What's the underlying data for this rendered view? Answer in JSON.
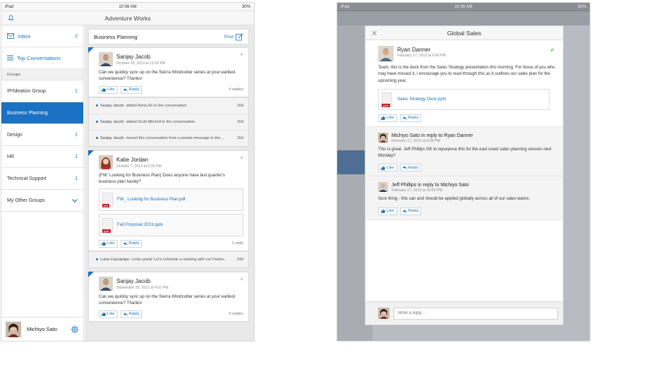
{
  "left": {
    "status": {
      "carrier": "iPad",
      "time": "10:36 AM",
      "battery": "30%"
    },
    "title": "Adventure Works",
    "nav": [
      {
        "label": "Inbox",
        "count": "2"
      },
      {
        "label": "Top Conversations",
        "count": ""
      }
    ],
    "groups_header": "Groups",
    "groups": [
      {
        "label": "IP/Ideation Group",
        "count": "1"
      },
      {
        "label": "Business Planning",
        "count": ""
      },
      {
        "label": "Design",
        "count": "1"
      },
      {
        "label": "HR",
        "count": "1"
      },
      {
        "label": "Technical Support",
        "count": "1"
      }
    ],
    "other_groups": "My Other Groups",
    "me": {
      "name": "Michiyo Sato"
    },
    "feed": {
      "title": "Business Planning",
      "post_label": "Post",
      "like_label": "Like",
      "reply_label": "Reply",
      "cards": [
        {
          "author": "Sanjay Jacob",
          "date": "October 25, 2013 at 12:53 PM",
          "body": "Can we quickly sync up on the Sierra Windcutter series at your earliest convenience? Thanks!",
          "replies": "4 replies",
          "activity": [
            {
              "who": "Sanjay Jacob:",
              "text": "added Anna Do to the conversation",
              "age": "16d"
            },
            {
              "who": "Sanjay Jacob:",
              "text": "added Scott Mitchell to the conversation.",
              "age": "16d"
            },
            {
              "who": "Sanjay Jacob:",
              "text": "moved this conversation from a private message to the ...",
              "age": "16d"
            }
          ]
        },
        {
          "author": "Katie Jordan",
          "date": "October 7, 2013 at 5:35 PM",
          "body": "{FW: Looking for Business Plan} Does anyone have last quarter's business plan handy?",
          "attachments": [
            {
              "name": "FW_ Looking for Business Plan.pdf",
              "type": "pdf"
            },
            {
              "name": "Fall Proposal 2013.pptx",
              "type": "pptx"
            }
          ],
          "replies": "1 reply",
          "activity": [
            {
              "who": "Luisa Cazzaniga:",
              "text": "Looks great! Let's schedule a meeting with our Partne...",
              "age": "24d"
            }
          ]
        },
        {
          "author": "Sanjay Jacob",
          "date": "September 25, 2012 at 4:01 PM",
          "body": "Can we quickly sync up on the Sierra Windcutter series at your earliest convenience? Thanks!",
          "replies": "4 replies"
        }
      ]
    }
  },
  "right": {
    "status": {
      "carrier": "iPad",
      "time": "10:36 AM",
      "battery": "30%"
    },
    "modal": {
      "title": "Global Sales",
      "like_label": "Like",
      "reply_label": "Reply",
      "messages": [
        {
          "author": "Ryan Danner",
          "date": "February 17, 2013 at 9:40 PM",
          "body": "Team, this is the deck from the Sales Strategy presentation this morning. For those of you who may have missed it, I encourage you to read through this as it outlines our sales plan for the upcoming year.",
          "attachment": {
            "name": "Sales Strategy Deck.pptx",
            "type": "pptx"
          }
        },
        {
          "author": "Michiyo Sato in reply to Ryan Danner",
          "date": "February 17, 2013 at 9:59 PM",
          "body": "This is great. Jeff Phillips OK to repurpose this for the east coast sales planning session next Monday?"
        },
        {
          "author": "Jeff Phillips in reply to Michiyo Sato",
          "date": "February 17, 2013 at 10:03 PM",
          "body": "Sure thing - this can and should be applied globally across all of our sales teams."
        }
      ],
      "composer_placeholder": "Write a reply..."
    }
  },
  "colors": {
    "accent": "#1a72c4",
    "link": "#1a72b6",
    "pdf_tag": "#c4232a"
  }
}
